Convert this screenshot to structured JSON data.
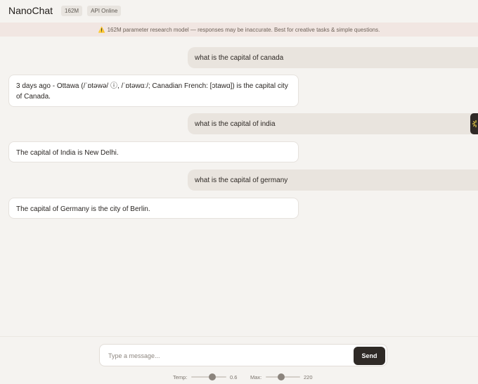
{
  "header": {
    "title": "NanoChat",
    "model_badge": "162M",
    "status_badge": "API Online"
  },
  "notice": {
    "icon": "warning-icon",
    "text": "162M parameter research model — responses may be inaccurate. Best for creative tasks & simple questions."
  },
  "messages": [
    {
      "role": "user",
      "text": "what is the capital of canada"
    },
    {
      "role": "assistant",
      "text": "3 days ago - Ottawa (/ˈɒtəwə/ ⓘ, /ˈɒtəwɑː/; Canadian French: [ɔtawɑ]) is the capital city of Canada."
    },
    {
      "role": "user",
      "text": "what is the capital of india"
    },
    {
      "role": "assistant",
      "text": "The capital of India is New Delhi."
    },
    {
      "role": "user",
      "text": "what is the capital of germany"
    },
    {
      "role": "assistant",
      "text": "The capital of Germany is the city of Berlin."
    }
  ],
  "composer": {
    "placeholder": "Type a message...",
    "value": "",
    "send_label": "Send"
  },
  "controls": {
    "temp_label": "Temp:",
    "temp_value": "0.6",
    "temp_fraction": 0.6,
    "max_label": "Max:",
    "max_value": "220",
    "max_fraction": 0.45
  },
  "colors": {
    "accent": "#2f2a26",
    "background": "#f5f3f0",
    "notice_bg": "#f1e6e2",
    "user_bubble": "#e9e4de"
  }
}
